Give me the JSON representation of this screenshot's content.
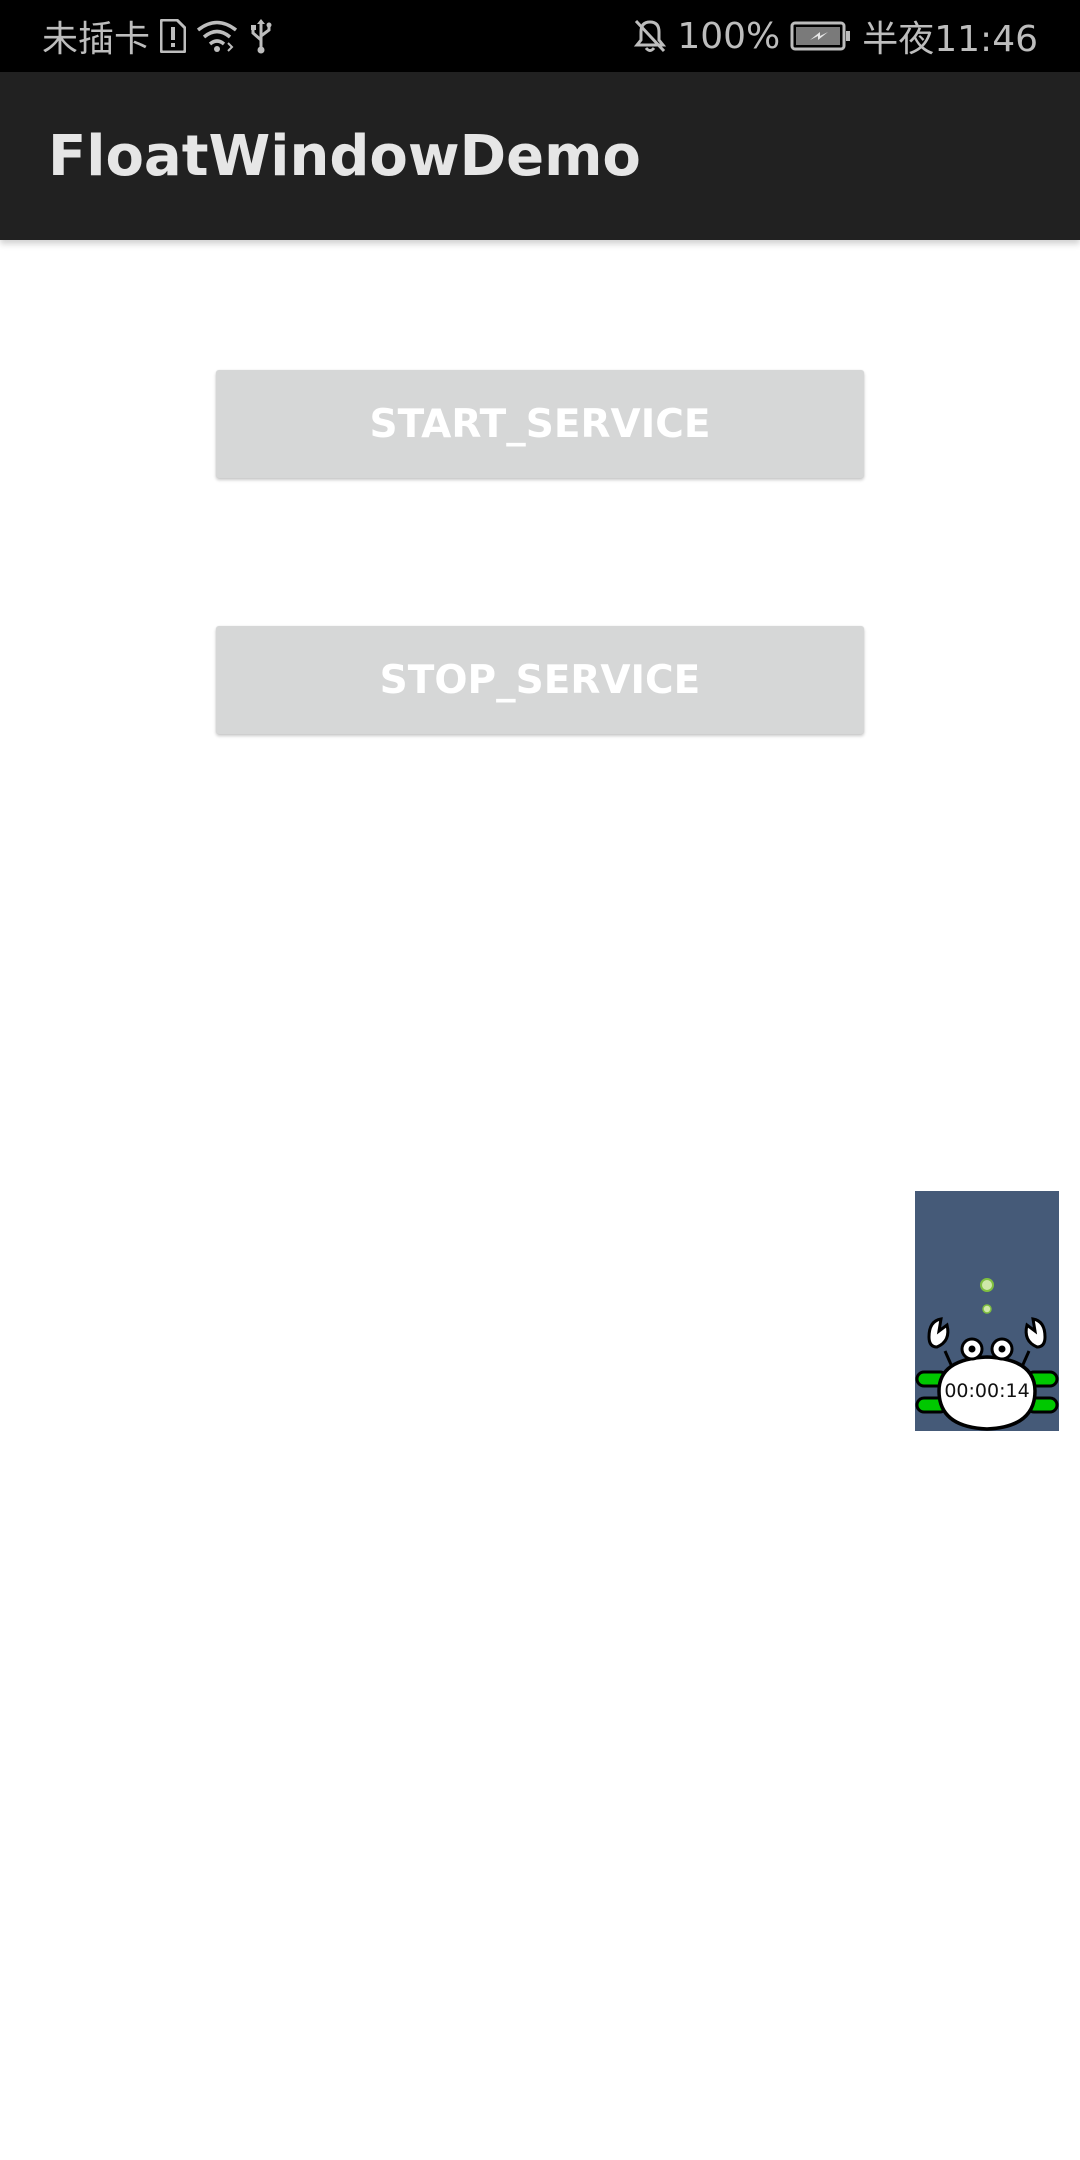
{
  "status_bar": {
    "carrier": "未插卡",
    "battery_percent": "100%",
    "time": "半夜11:46",
    "icons": [
      "sim-alert-icon",
      "wifi-icon",
      "usb-icon",
      "notifications-off-icon",
      "battery-charging-icon"
    ]
  },
  "app_bar": {
    "title": "FloatWindowDemo"
  },
  "buttons": {
    "start_label": "START_SERVICE",
    "stop_label": "STOP_SERVICE"
  },
  "float_window": {
    "timer": "00:00:14",
    "mascot": "crab-icon",
    "colors": {
      "background": "#455a78",
      "accent": "#00c800"
    }
  }
}
